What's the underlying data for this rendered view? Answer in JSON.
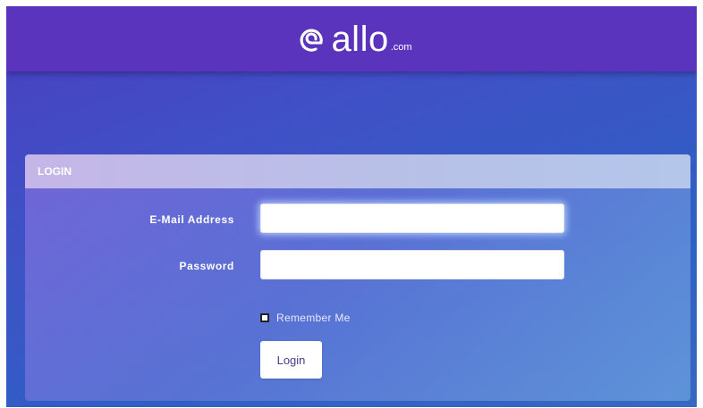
{
  "header": {
    "logo_text": "allo",
    "logo_suffix": ".com",
    "logo_icon": "allo-swirl-logo"
  },
  "login_panel": {
    "title": "LOGIN",
    "email_label": "E-Mail Address",
    "email_value": "",
    "password_label": "Password",
    "password_value": "",
    "remember_label": "Remember Me",
    "remember_checked": false,
    "submit_label": "Login"
  },
  "colors": {
    "header_bg": "#5a34bd",
    "background_gradient": [
      "#4a3ec0",
      "#3f51c6",
      "#2f5fc4",
      "#3768c2"
    ],
    "panel_header_bg": "#c5b6e8",
    "button_text": "#4a3a8c"
  }
}
